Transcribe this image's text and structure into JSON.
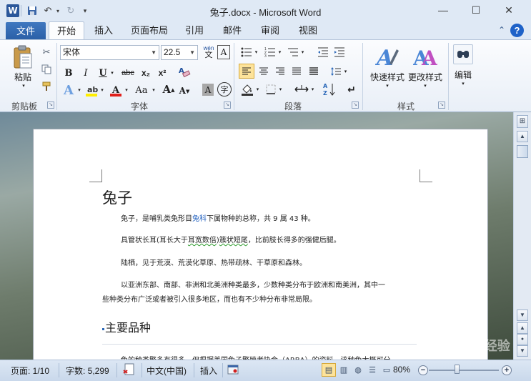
{
  "window": {
    "title": "兔子.docx - Microsoft Word",
    "app_icon_letter": "W",
    "minimize": "—",
    "maximize": "☐",
    "close": "✕"
  },
  "qat": {
    "save": "💾",
    "undo": "↶",
    "redo": "↻",
    "customize": "▾"
  },
  "tabs": {
    "file": "文件",
    "items": [
      "开始",
      "插入",
      "页面布局",
      "引用",
      "邮件",
      "审阅",
      "视图"
    ],
    "active": "开始",
    "collapse": "⌃",
    "help": "?"
  },
  "clipboard": {
    "group_label": "剪贴板",
    "paste_label": "粘贴"
  },
  "font": {
    "group_label": "字体",
    "font_name": "宋体",
    "font_size": "22.5",
    "bold": "B",
    "italic": "I",
    "underline": "U",
    "strikethrough": "abc",
    "subscript": "x₂",
    "superscript": "x²",
    "change_case": "Aa",
    "grow": "A",
    "shrink": "A",
    "phonetic": "wén",
    "enclose": "字",
    "char_border": "A",
    "char_shade": "A"
  },
  "paragraph": {
    "group_label": "段落"
  },
  "styles": {
    "group_label": "样式",
    "quick_styles": "快速样式",
    "change_styles": "更改样式"
  },
  "editing": {
    "label": "编辑"
  },
  "document": {
    "heading": "兔子",
    "p1_a": "兔子，是哺乳类兔形目",
    "p1_link": "兔科",
    "p1_b": "下属物种的总称，共 9 属 43 种。",
    "p2_a": "具管状长耳(耳长大于",
    "p2_sq": "耳宽数倍",
    "p2_b": ")",
    "p2_sq2": "簇状短尾",
    "p2_c": "，比前肢长得多的强健后腿。",
    "p3": "陆栖，见于荒漠、荒漠化草原、热带疏林、干草原和森林。",
    "p4_l1": "以亚洲东部、南部、非洲和北美洲种类最多，少数种类分布于欧洲和南美洲，其中一",
    "p4_l2": "些种类分布广泛或者被引入很多地区，而也有不少种分布非常局限。",
    "subheading": "主要品种",
    "p5_partial": "兔的种类繁多有很多，但根据美国兔子繁殖者协会（ARBA）的资料，该种兔大概可分"
  },
  "status": {
    "page": "页面: 1/10",
    "words": "字数: 5,299",
    "language": "中文(中国)",
    "mode": "插入",
    "zoom": "80%",
    "zoom_out": "−",
    "zoom_in": "+"
  },
  "watermark": "Baidu经验"
}
